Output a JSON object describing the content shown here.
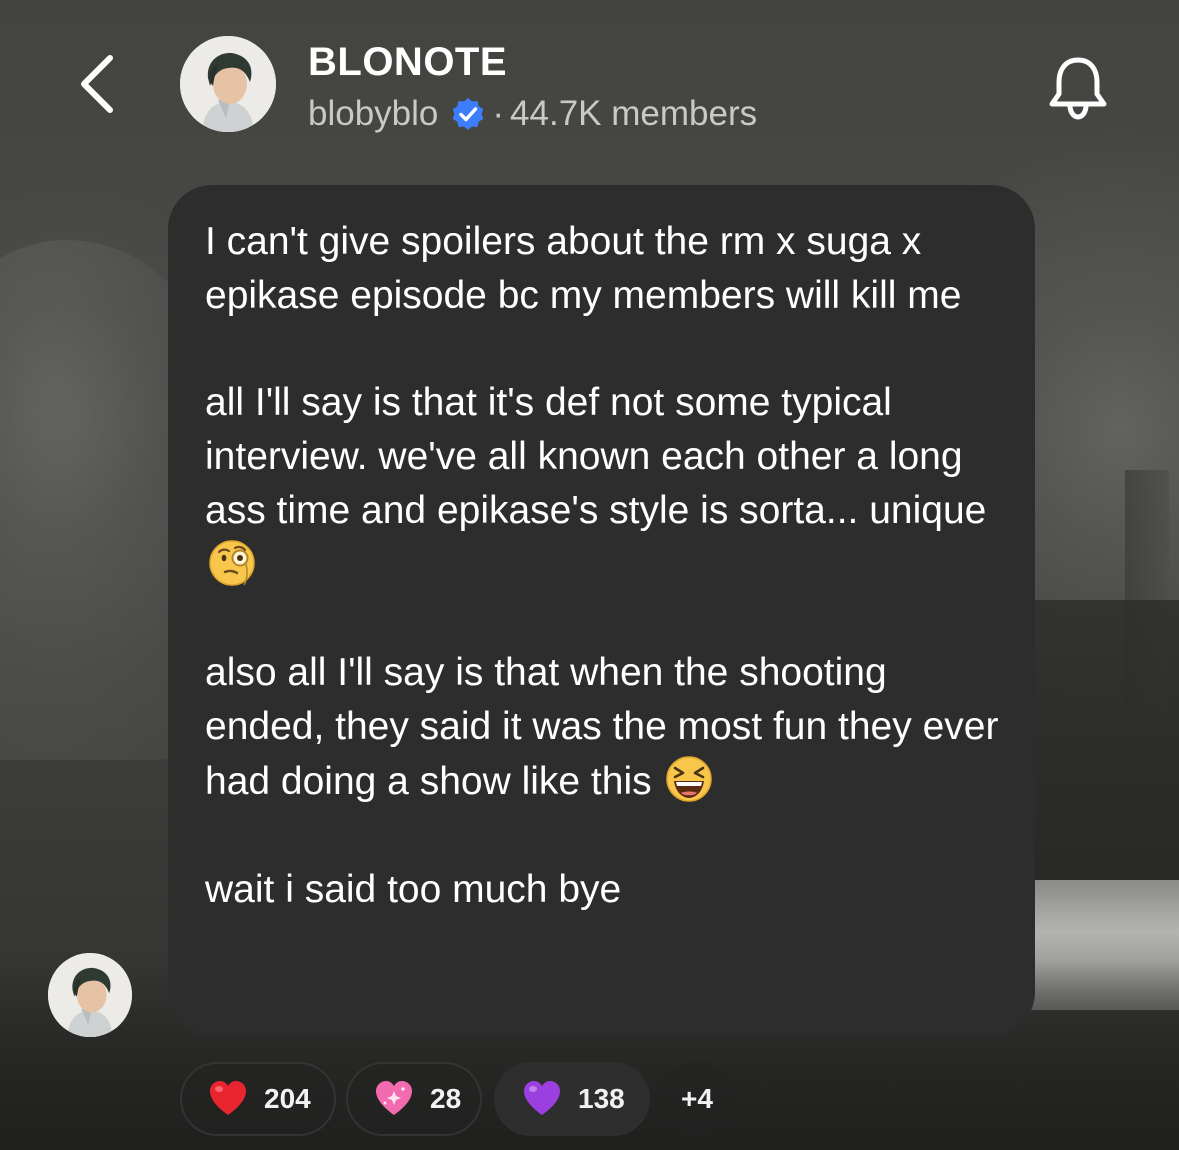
{
  "header": {
    "channel_name": "BLONOTE",
    "handle": "blobyblo",
    "separator": "·",
    "members": "44.7K members",
    "back_icon": "chevron-left-icon",
    "notification_icon": "bell-icon",
    "verified_icon": "verified-badge-icon"
  },
  "message": {
    "paragraphs": [
      {
        "text": "I can't give spoilers about the rm x suga x epikase episode bc my members will kill me"
      },
      {
        "text": "all I'll say is that it's def not some typical interview. we've all known each other a long ass time and epikase's style is sorta... unique",
        "emoji": "face-with-monocle-emoji"
      },
      {
        "text": "also all I'll say is that when the shooting ended, they said it was the most fun they ever had doing a show like this ",
        "emoji": "grinning-squinting-face-emoji"
      },
      {
        "text": "wait i said too much bye"
      }
    ]
  },
  "reactions": {
    "items": [
      {
        "icon": "red-heart-icon",
        "count": "204",
        "color": "#e8242e"
      },
      {
        "icon": "sparkling-pink-heart-icon",
        "count": "28",
        "color": "#f26bb0"
      },
      {
        "icon": "purple-heart-icon",
        "count": "138",
        "color": "#9b3fe0"
      }
    ],
    "more": "+4"
  },
  "colors": {
    "bubble": "#2d2d2d",
    "verified": "#3d7eff",
    "text": "#ffffff",
    "subtext": "#c9cac6"
  }
}
